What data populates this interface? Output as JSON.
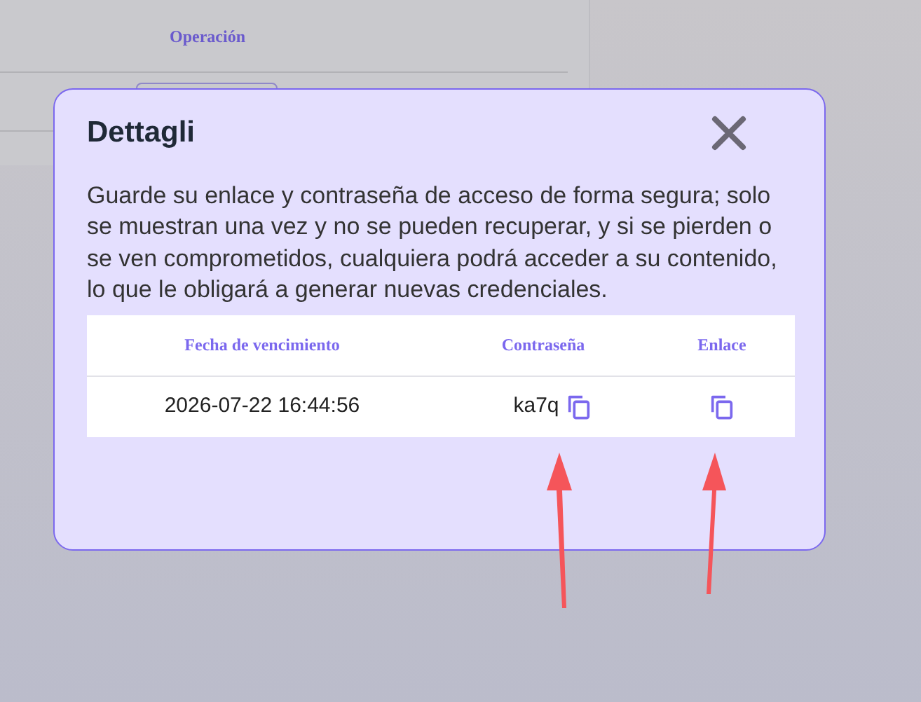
{
  "background_table": {
    "columns": [
      "Operación"
    ]
  },
  "dialog": {
    "title": "Dettagli",
    "message": "Guarde su enlace y contraseña de acceso de forma segura; solo se muestran una vez y no se pueden recuperar, y si se pierden o se ven comprometidos, cualquiera podrá acceder a su contenido, lo que le obligará a generar nuevas credenciales.",
    "table": {
      "columns": [
        "Fecha de vencimiento",
        "Contraseña",
        "Enlace"
      ],
      "rows": [
        {
          "expiry": "2026-07-22 16:44:56",
          "password": "ka7q"
        }
      ]
    }
  }
}
